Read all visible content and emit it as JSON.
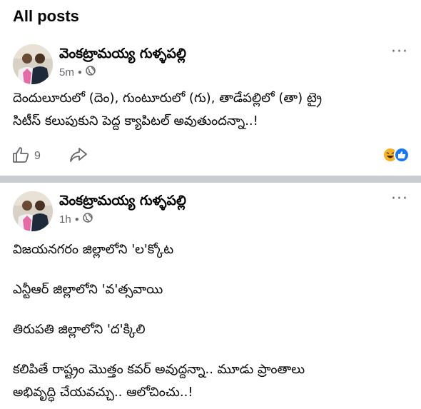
{
  "page": {
    "section_title": "All posts"
  },
  "posts": [
    {
      "author": "వెంకట్రామయ్య గుళ్ళపల్లి",
      "time": "5m",
      "lines": [
        "దెందులూరులో (దెం), గుంటూరులో (గు), తాడేపల్లిలో (తా) ట్రై",
        "సిటీస్ కలుపుకుని పెద్ద క్యాపిటల్ అవుతుందన్నా..!"
      ],
      "likes": "9",
      "reactions": [
        "haha-icon",
        "like-icon"
      ]
    },
    {
      "author": "వెంకట్రామయ్య గుళ్ళపల్లి",
      "time": "1h",
      "lines": [
        "విజయనగరం జిల్లాలోని 'ల'క్కోట",
        "ఎన్టీఆర్ జిల్లాలోని 'వ'త్సవాయి",
        "తిరుపతి జిల్లాలోని 'ద'క్కిలి",
        "కలిపితే రాష్ట్రం మొత్తం కవర్ అవుద్దన్నా.. మూడు ప్రాంతాలు",
        "అభివృద్ధి చేయవచ్చు.. ఆలోచించు..!"
      ]
    }
  ],
  "colors": {
    "secondary_text": "#65676b",
    "like_blue": "#1877f2",
    "haha_yellow": "#f7b125",
    "divider": "#c9ccd1"
  }
}
